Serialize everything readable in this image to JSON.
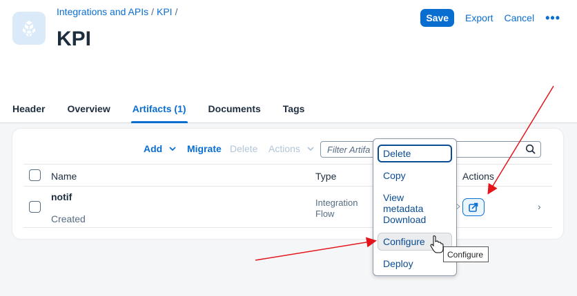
{
  "header": {
    "breadcrumb": [
      {
        "label": "Integrations and APIs"
      },
      {
        "label": "KPI"
      }
    ],
    "separator": "/",
    "title": "KPI",
    "actions": {
      "save": "Save",
      "export": "Export",
      "cancel": "Cancel",
      "more": "•••"
    }
  },
  "tabs": [
    {
      "label": "Header",
      "active": false
    },
    {
      "label": "Overview",
      "active": false
    },
    {
      "label": "Artifacts (1)",
      "active": true
    },
    {
      "label": "Documents",
      "active": false
    },
    {
      "label": "Tags",
      "active": false
    }
  ],
  "table": {
    "toolbar": {
      "add": "Add",
      "migrate": "Migrate",
      "delete": "Delete",
      "actions": "Actions",
      "search_placeholder": "Filter Artifa"
    },
    "columns": {
      "name": "Name",
      "type": "Type",
      "actions": "Actions"
    },
    "rows": [
      {
        "name": "notif",
        "status": "Created",
        "type_line1": "Integration",
        "type_line2": "Flow"
      }
    ]
  },
  "menu": {
    "items": [
      "Delete",
      "Copy",
      "View metadata",
      "Download",
      "Configure",
      "Deploy"
    ]
  },
  "tooltip": "Configure",
  "colors": {
    "accent": "#0a6ed1",
    "annotation": "#e5141b"
  }
}
